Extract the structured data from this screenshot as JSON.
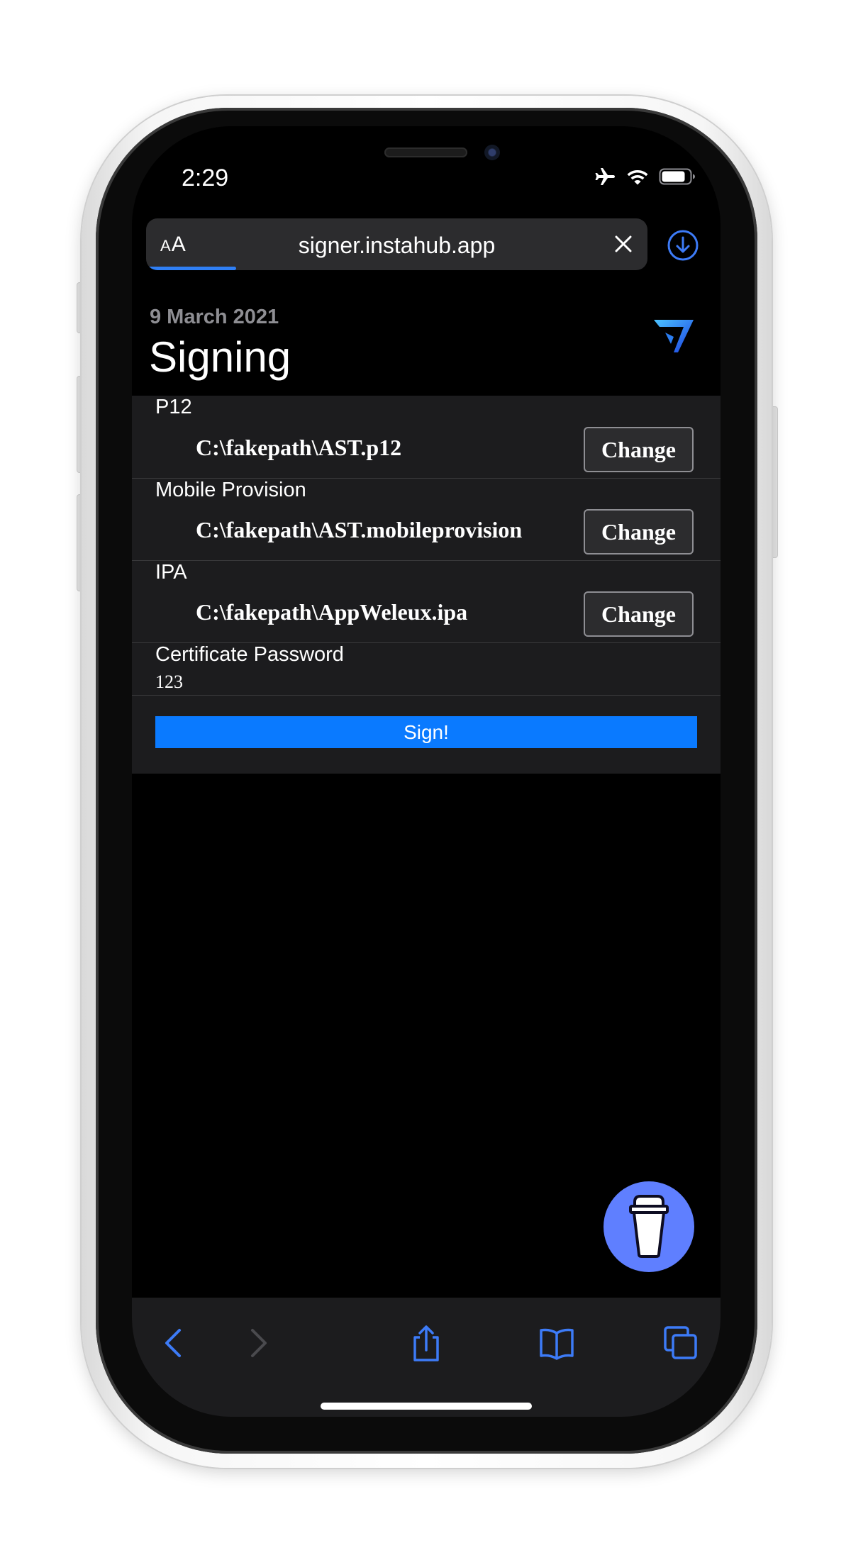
{
  "status_bar": {
    "time": "2:29",
    "icons": [
      "airplane-icon",
      "wifi-icon",
      "battery-icon"
    ]
  },
  "browser": {
    "text_size_label_small": "A",
    "text_size_label_large": "A",
    "url": "signer.instahub.app",
    "load_progress": 0.18,
    "accent_color": "#2f7ff5"
  },
  "page": {
    "date": "9 March 2021",
    "title": "Signing"
  },
  "form": {
    "p12": {
      "label": "P12",
      "file": "C:\\fakepath\\AST.p12",
      "button": "Change"
    },
    "provision": {
      "label": "Mobile Provision",
      "file": "C:\\fakepath\\AST.mobileprovision",
      "button": "Change"
    },
    "ipa": {
      "label": "IPA",
      "file": "C:\\fakepath\\AppWeleux.ipa",
      "button": "Change"
    },
    "password": {
      "label": "Certificate Password",
      "value": "123"
    },
    "submit": "Sign!",
    "submit_color": "#0a7aff"
  },
  "toolbar": {
    "icons": [
      "back-icon",
      "forward-icon",
      "share-icon",
      "bookmarks-icon",
      "tabs-icon"
    ],
    "tint": "#3d7bf7"
  },
  "fab": {
    "icon": "coffee-cup-icon",
    "color": "#5f7fff"
  }
}
